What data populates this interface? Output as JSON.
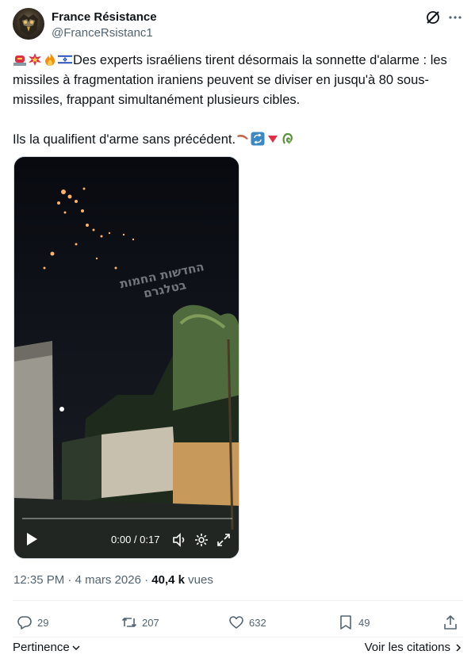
{
  "author": {
    "name": "France Résistance",
    "handle": "@FranceRsistanc1"
  },
  "header_icons": [
    "grok-icon",
    "more-icon"
  ],
  "tweet": {
    "leading_emojis": [
      "rotating-light-emoji",
      "collision-emoji",
      "fire-emoji",
      "israel-flag-emoji"
    ],
    "line1": "Des experts israéliens tirent désormais la sonnette d'alarme : les missiles à fragmentation iraniens peuvent se diviser en jusqu'à 80 sous-missiles, frappant simultanément plusieurs cibles.",
    "line2": "Ils la qualifient d'arme sans précédent.",
    "trailing_emojis": [
      "boomerang-emoji",
      "repeat-emoji",
      "red-triangle-down-emoji",
      "ribbon-emoji"
    ]
  },
  "video": {
    "watermark": "החדשות החמות בטלגרם",
    "time": "0:00 / 0:17",
    "progress": 0
  },
  "meta": {
    "time": "12:35 PM",
    "separator": " · ",
    "date": "4 mars 2026",
    "views": "40,4 k",
    "views_label": " vues"
  },
  "actions": {
    "replies": "29",
    "reposts": "207",
    "likes": "632",
    "bookmarks": "49"
  },
  "footer": {
    "sort_label": "Pertinence",
    "quotes_label": "Voir les citations"
  },
  "colors": {
    "text": "#0f1419",
    "secondary": "#536471",
    "divider": "#eff3f4"
  }
}
